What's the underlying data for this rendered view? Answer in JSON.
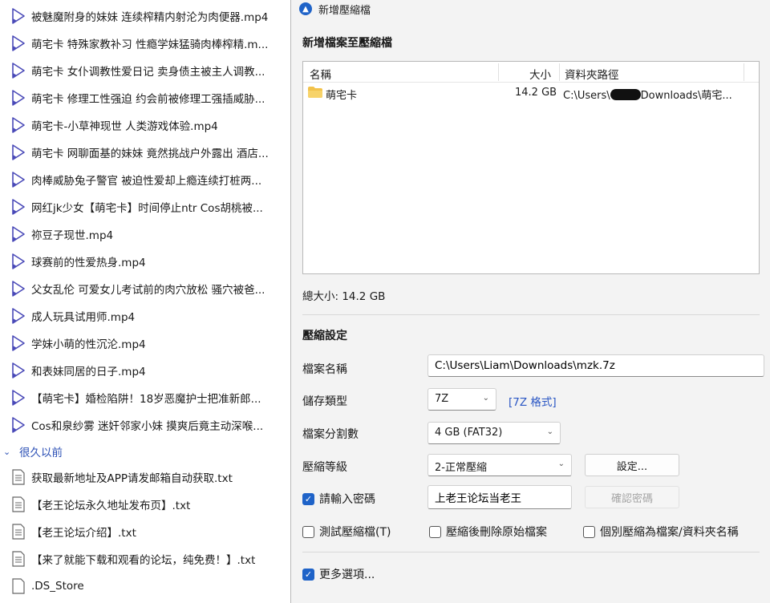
{
  "file_list": {
    "video_files": [
      "被魅魔附身的妹妹 连续榨精内射沦为肉便器.mp4",
      "萌宅卡 特殊家教补习 性瘾学妹猛骑肉棒榨精.m...",
      "萌宅卡 女仆调教性爱日记 卖身债主被主人调教...",
      "萌宅卡 修理工性强迫 约会前被修理工强插威胁...",
      "萌宅卡-小草神现世 人类游戏体验.mp4",
      "萌宅卡 网聊面基的妹妹 竟然挑战户外露出 酒店...",
      "肉棒威胁兔子警官 被迫性爱却上瘾连续打桩两...",
      "网红jk少女【萌宅卡】时间停止ntr Cos胡桃被...",
      "祢豆子现世.mp4",
      "球赛前的性爱热身.mp4",
      "父女乱伦 可爱女儿考试前的肉穴放松 骚穴被爸...",
      "成人玩具试用师.mp4",
      "学妹小萌的性沉沦.mp4",
      "和表妹同居的日子.mp4",
      "【萌宅卡】婚检陷阱！18岁恶魔护士把准新郎...",
      "Cos和泉纱雾 迷奸邻家小妹 摸爽后竟主动深喉..."
    ],
    "group_label": "很久以前",
    "old_files": [
      "获取最新地址及APP请发邮箱自动获取.txt",
      "【老王论坛永久地址发布页】.txt",
      "【老王论坛介绍】.txt",
      "【来了就能下载和观看的论坛，纯免费！】.txt",
      ".DS_Store"
    ]
  },
  "dialog": {
    "title": "新增壓縮檔",
    "add_section_title": "新增檔案至壓縮檔",
    "columns": {
      "name": "名稱",
      "size": "大小",
      "path": "資料夾路徑"
    },
    "row": {
      "name": "萌宅卡",
      "size": "14.2 GB",
      "path_prefix": "C:\\Users\\",
      "path_suffix": "Downloads\\萌宅..."
    },
    "total_size": "總大小: 14.2 GB",
    "settings_title": "壓縮設定",
    "labels": {
      "filename": "檔案名稱",
      "storage_type": "儲存類型",
      "split_size": "檔案分割數",
      "level": "壓縮等級"
    },
    "filename_value": "C:\\Users\\Liam\\Downloads\\mzk.7z",
    "storage_type_value": "7Z",
    "format_link": "[7Z 格式]",
    "split_value": "4 GB (FAT32)",
    "level_value": "2-正常壓縮",
    "settings_button": "設定...",
    "password_check": "請輸入密碼",
    "password_value": "上老王论坛当老王",
    "confirm_password_button": "確認密碼",
    "test_archive": "測試壓縮檔(T)",
    "delete_after": "壓縮後刪除原始檔案",
    "separate_archives": "個別壓縮為檔案/資料夾名稱",
    "more_options": "更多選項..."
  }
}
